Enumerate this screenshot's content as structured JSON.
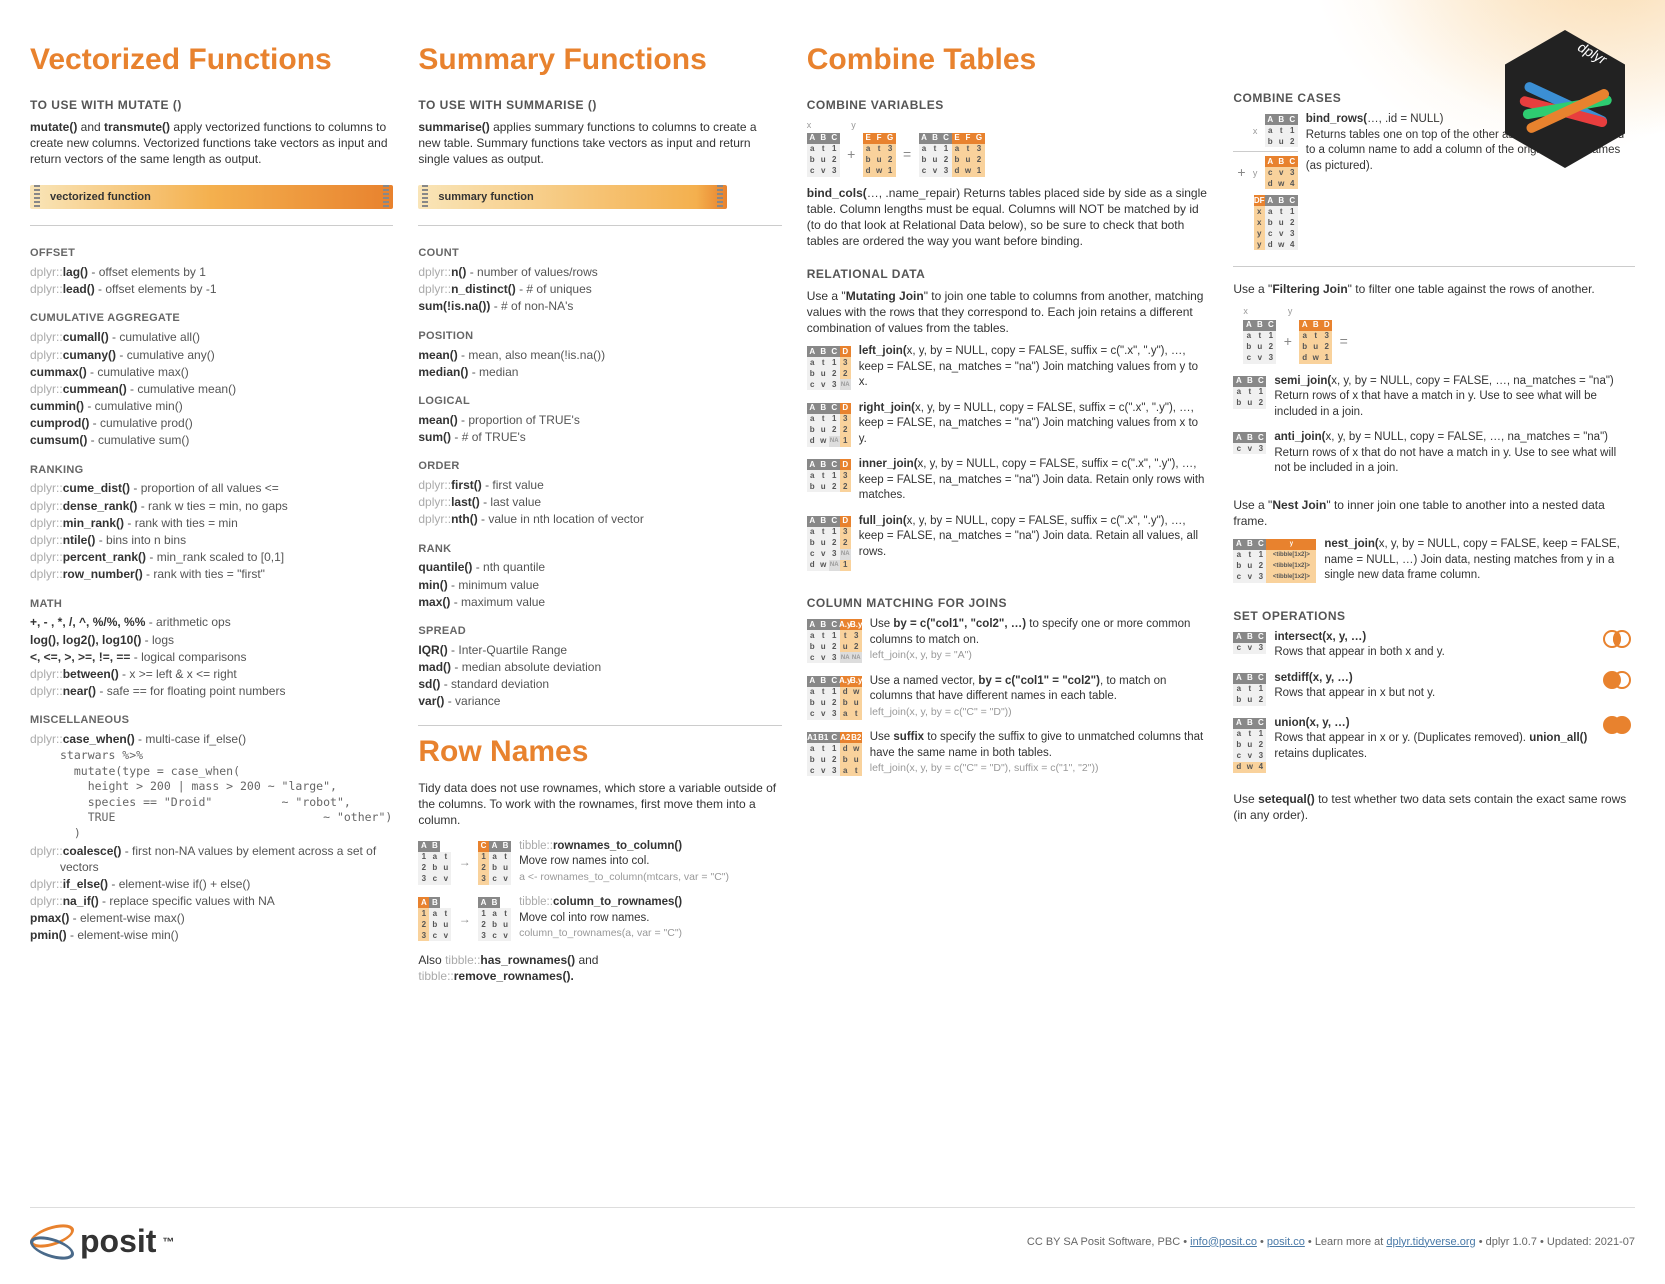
{
  "hex_label": "dplyr",
  "col1": {
    "title": "Vectorized Functions",
    "subhead": "TO USE WITH MUTATE ()",
    "intro": "mutate() and transmute() apply vectorized functions to columns to create new columns. Vectorized functions take vectors as input and return vectors of the same length as output.",
    "bar": "vectorized function",
    "groups": [
      {
        "name": "OFFSET",
        "items": [
          {
            "pkg": "dplyr::",
            "fn": "lag()",
            "desc": " - offset elements by 1"
          },
          {
            "pkg": "dplyr::",
            "fn": "lead()",
            "desc": " - offset elements by -1"
          }
        ]
      },
      {
        "name": "CUMULATIVE AGGREGATE",
        "items": [
          {
            "pkg": "dplyr::",
            "fn": "cumall()",
            "desc": " - cumulative all()"
          },
          {
            "pkg": "dplyr::",
            "fn": "cumany()",
            "desc": " - cumulative any()"
          },
          {
            "pkg": "",
            "fn": "cummax()",
            "desc": " - cumulative max()"
          },
          {
            "pkg": "dplyr::",
            "fn": "cummean()",
            "desc": " - cumulative mean()"
          },
          {
            "pkg": "",
            "fn": "cummin()",
            "desc": " - cumulative min()"
          },
          {
            "pkg": "",
            "fn": "cumprod()",
            "desc": " - cumulative prod()"
          },
          {
            "pkg": "",
            "fn": "cumsum()",
            "desc": " - cumulative sum()"
          }
        ]
      },
      {
        "name": "RANKING",
        "items": [
          {
            "pkg": "dplyr::",
            "fn": "cume_dist()",
            "desc": " - proportion of all values <="
          },
          {
            "pkg": "dplyr::",
            "fn": "dense_rank()",
            "desc": " - rank w ties = min, no gaps"
          },
          {
            "pkg": "dplyr::",
            "fn": "min_rank()",
            "desc": " - rank with ties = min"
          },
          {
            "pkg": "dplyr::",
            "fn": "ntile()",
            "desc": " - bins into n bins"
          },
          {
            "pkg": "dplyr::",
            "fn": "percent_rank()",
            "desc": " - min_rank scaled to [0,1]"
          },
          {
            "pkg": "dplyr::",
            "fn": "row_number()",
            "desc": " - rank with ties = \"first\""
          }
        ]
      },
      {
        "name": "MATH",
        "items": [
          {
            "pkg": "",
            "fn": "+, - , *, /, ^, %/%, %%",
            "desc": " - arithmetic ops"
          },
          {
            "pkg": "",
            "fn": "log(), log2(), log10()",
            "desc": " - logs"
          },
          {
            "pkg": "",
            "fn": "<, <=, >, >=, !=, ==",
            "desc": " - logical comparisons"
          },
          {
            "pkg": "dplyr::",
            "fn": "between()",
            "desc": " - x >= left & x <= right"
          },
          {
            "pkg": "dplyr::",
            "fn": "near()",
            "desc": " - safe == for floating point numbers"
          }
        ]
      },
      {
        "name": "MISCELLANEOUS",
        "items": [
          {
            "pkg": "dplyr::",
            "fn": "case_when()",
            "desc": " - multi-case if_else()"
          }
        ],
        "code": "starwars %>%\n  mutate(type = case_when(\n    height > 200 | mass > 200 ~ \"large\",\n    species == \"Droid\"          ~ \"robot\",\n    TRUE                              ~ \"other\")\n  )",
        "items2": [
          {
            "pkg": "dplyr::",
            "fn": "coalesce()",
            "desc": " - first non-NA values by element  across a set of vectors"
          },
          {
            "pkg": "dplyr::",
            "fn": "if_else()",
            "desc": " - element-wise if() + else()"
          },
          {
            "pkg": "dplyr::",
            "fn": "na_if()",
            "desc": " - replace specific values with NA"
          },
          {
            "pkg": "",
            "fn": "pmax()",
            "desc": " - element-wise max()"
          },
          {
            "pkg": "",
            "fn": "pmin()",
            "desc": " - element-wise min()"
          }
        ]
      }
    ]
  },
  "col2": {
    "title": "Summary Functions",
    "subhead": "TO USE WITH SUMMARISE ()",
    "intro": "summarise() applies summary functions to columns to create a new table. Summary functions take vectors as input and return single values as output.",
    "bar": "summary function",
    "groups": [
      {
        "name": "COUNT",
        "items": [
          {
            "pkg": "dplyr::",
            "fn": "n()",
            "desc": " - number of values/rows"
          },
          {
            "pkg": "dplyr::",
            "fn": "n_distinct()",
            "desc": " - # of uniques"
          },
          {
            "pkg": "",
            "fn": "sum(!is.na())",
            "desc": " - # of non-NA's"
          }
        ]
      },
      {
        "name": "POSITION",
        "items": [
          {
            "pkg": "",
            "fn": "mean()",
            "desc": " - mean, also mean(!is.na())"
          },
          {
            "pkg": "",
            "fn": "median()",
            "desc": " - median"
          }
        ]
      },
      {
        "name": "LOGICAL",
        "items": [
          {
            "pkg": "",
            "fn": "mean()",
            "desc": " - proportion of TRUE's"
          },
          {
            "pkg": "",
            "fn": "sum()",
            "desc": " - # of TRUE's"
          }
        ]
      },
      {
        "name": "ORDER",
        "items": [
          {
            "pkg": "dplyr::",
            "fn": "first()",
            "desc": " - first value"
          },
          {
            "pkg": "dplyr::",
            "fn": "last()",
            "desc": " - last value"
          },
          {
            "pkg": "dplyr::",
            "fn": "nth()",
            "desc": " - value in nth location of vector"
          }
        ]
      },
      {
        "name": "RANK",
        "items": [
          {
            "pkg": "",
            "fn": "quantile()",
            "desc": " - nth quantile"
          },
          {
            "pkg": "",
            "fn": "min()",
            "desc": " - minimum value"
          },
          {
            "pkg": "",
            "fn": "max()",
            "desc": " - maximum value"
          }
        ]
      },
      {
        "name": "SPREAD",
        "items": [
          {
            "pkg": "",
            "fn": "IQR()",
            "desc": " - Inter-Quartile Range"
          },
          {
            "pkg": "",
            "fn": "mad()",
            "desc": " - median absolute deviation"
          },
          {
            "pkg": "",
            "fn": "sd()",
            "desc": " - standard deviation"
          },
          {
            "pkg": "",
            "fn": "var()",
            "desc": " - variance"
          }
        ]
      }
    ],
    "rownames": {
      "title": "Row Names",
      "intro": "Tidy data does not use rownames, which store a variable outside of the columns. To work with the rownames, first move them into a column.",
      "r2c_fn": "rownames_to_column()",
      "r2c_desc": "Move row names into col.",
      "r2c_code": "a <- rownames_to_column(mtcars, var = \"C\")",
      "c2r_fn": "column_to_rownames()",
      "c2r_desc": "Move col into row names.",
      "c2r_code": "column_to_rownames(a, var = \"C\")",
      "also_pre": "Also ",
      "also_pkg": "tibble::",
      "has_fn": "has_rownames()",
      "also_and": " and ",
      "remove_fn": "remove_rownames()."
    }
  },
  "col3": {
    "title": "Combine Tables",
    "combine_vars": {
      "head": "COMBINE VARIABLES",
      "bind_cols_fn": "bind_cols(",
      "bind_cols_sig": "…, .name_repair)",
      "bind_cols_desc": " Returns tables placed side by side as a single table. Column lengths must be equal. Columns will NOT be matched by id (to do that look at Relational Data below), so be sure to check that both tables are ordered the way you want before binding."
    },
    "relational": {
      "head": "RELATIONAL DATA",
      "intro_pre": "Use a \"",
      "intro_bold": "Mutating Join",
      "intro_post": "\" to join one table to columns from another, matching values with the rows that they correspond to. Each join retains a different combination of values from the tables.",
      "joins": [
        {
          "fn": "left_join(",
          "sig": "x, y, by = NULL, copy = FALSE, suffix = c(\".x\", \".y\"), …, keep = FALSE, na_matches = \"na\")",
          "desc": " Join matching values from y to x."
        },
        {
          "fn": "right_join(",
          "sig": "x, y, by = NULL, copy = FALSE, suffix = c(\".x\", \".y\"), …, keep = FALSE, na_matches = \"na\")",
          "desc": " Join matching values from x to y."
        },
        {
          "fn": "inner_join(",
          "sig": "x, y, by = NULL, copy = FALSE, suffix = c(\".x\", \".y\"), …, keep = FALSE, na_matches = \"na\")",
          "desc": " Join data. Retain only rows with matches."
        },
        {
          "fn": "full_join(",
          "sig": "x, y, by = NULL, copy = FALSE, suffix = c(\".x\", \".y\"), …, keep = FALSE, na_matches = \"na\")",
          "desc": " Join data. Retain all values, all rows."
        }
      ]
    },
    "matching": {
      "head": "COLUMN MATCHING FOR JOINS",
      "m1_pre": "Use ",
      "m1_fn": "by = c(\"col1\", \"col2\", …)",
      "m1_post": "  to specify one or more common columns to match on.",
      "m1_ex": "left_join(x, y, by = \"A\")",
      "m2_pre": "Use a named vector,  ",
      "m2_fn": "by = c(\"col1\" = \"col2\")",
      "m2_post": ", to match on columns that have different names in each table.",
      "m2_ex": "left_join(x, y, by = c(\"C\" = \"D\"))",
      "m3_pre": "Use ",
      "m3_fn": "suffix",
      "m3_post": " to specify the suffix to give to unmatched columns that have the same name in both tables.",
      "m3_ex": "left_join(x, y, by = c(\"C\" = \"D\"), suffix = c(\"1\", \"2\"))"
    }
  },
  "col4": {
    "combine_cases": {
      "head": "COMBINE CASES",
      "bind_rows_fn": "bind_rows(",
      "bind_rows_sig": "…, .id = NULL)",
      "bind_rows_desc": " Returns tables one on top of the other as a single table. Set .id to a column name to add a column of the original table names (as pictured)."
    },
    "filtering": {
      "intro_pre": "Use a \"",
      "intro_bold": "Filtering Join",
      "intro_post": "\" to filter one table against the rows of another.",
      "semi_fn": "semi_join(",
      "semi_sig": "x, y, by = NULL, copy = FALSE, …, na_matches = \"na\")",
      "semi_desc": " Return rows of x that have a match in y.  Use to see what will be included in a join.",
      "anti_fn": "anti_join(",
      "anti_sig": "x, y, by = NULL, copy = FALSE, …, na_matches = \"na\")",
      "anti_desc": " Return rows of x that do not have a match in y. Use to see what will not be included in a join."
    },
    "nest": {
      "intro_pre": "Use a \"",
      "intro_bold": "Nest Join",
      "intro_post": "\" to inner join one table to another into a nested data frame.",
      "fn": "nest_join(",
      "sig": "x, y, by = NULL, copy = FALSE, keep = FALSE, name = NULL, …)",
      "desc": " Join data, nesting matches from y in a single new data frame column."
    },
    "setops": {
      "head": "SET OPERATIONS",
      "intersect_fn": "intersect(x, y, …)",
      "intersect_desc": "Rows that appear in both x and y.",
      "setdiff_fn": "setdiff(x, y, …)",
      "setdiff_desc": "Rows that appear in x but not y.",
      "union_fn": "union(x, y, …)",
      "union_desc_pre": "Rows that appear in x or y. (Duplicates removed). ",
      "union_all_fn": "union_all()",
      "union_desc_post": " retains duplicates.",
      "setequal_pre": "Use ",
      "setequal_fn": "setequal()",
      "setequal_post": " to test whether two data sets contain the exact same rows (in any order)."
    }
  },
  "footer": {
    "posit": "posit",
    "cc": "CC BY SA Posit Software, PBC • ",
    "email": "info@posit.co",
    "dot1": " • ",
    "site": "posit.co",
    "learn": " • Learn more at ",
    "learn_url": "dplyr.tidyverse.org",
    "version": " • dplyr  1.0.7 •  Updated:  2021-07"
  }
}
